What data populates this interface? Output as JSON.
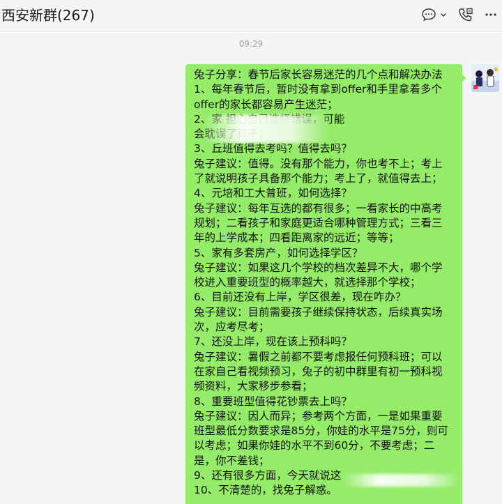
{
  "header": {
    "title": "西安新群(267)",
    "actions": [
      {
        "name": "chat-bubble-icon",
        "has_dropdown": true
      },
      {
        "name": "phone-icon"
      },
      {
        "name": "more-icon"
      }
    ]
  },
  "timestamp": "09:29",
  "message": {
    "sender": "self",
    "bubble_color": "#95ec69",
    "lines": [
      "兔子分享：春节后家长容易迷茫的几个点和解决办法",
      "1、每年春节后，暂时没有拿到offer和手里拿着多个",
      "offer的家长都容易产生迷茫；",
      "2、家                                   担心自己选择错误，可能",
      "会耽误了孩子；",
      "3、丘班值得去考吗？值得去吗？",
      "兔子建议：值得。没有那个能力，你也考不上；考上",
      "了就说明孩子具备那个能力；考上了，就值得去上；",
      "4、元培和工大普班，如何选择？",
      "兔子建议：每年互选的都有很多；一看家长的中高考",
      "规划；二看孩子和家庭更适合哪种管理方式；三看三",
      "年的上学成本；四看距离家的远近；等等；",
      "5、家有多套房产，如何选择学区？",
      "兔子建议：如果这几个学校的档次差异不大，哪个学",
      "校进入重要班型的概率越大，就选择那个学校；",
      "6、目前还没有上岸，学区很差，现在咋办？",
      "兔子建议：目前需要孩子继续保持状态，后续真实场",
      "次，应考尽考；",
      "7、还没上岸，现在该上预科吗？",
      "兔子建议：暑假之前都不要考虑报任何预科班；可以",
      "在家自己看视频预习，兔子的初中群里有初一预科视",
      "频资料，大家移步参看；",
      "8、重要班型值得花钞票去上吗？",
      "兔子建议：因人而异；参考两个方面，一是如果重要",
      "班型最低分数要求是85分，你娃的水平是75分，则可",
      "以考虑；如果你娃的水平不到60分，不要考虑；二",
      "是，你不差钱；",
      "9、还有很多方面，今天就说这",
      "10、不清楚的，找兔子解惑。"
    ]
  },
  "colors": {
    "background": "#f5f5f5",
    "bubble": "#95ec69",
    "text": "#111111",
    "timestamp": "#9e9e9e"
  }
}
